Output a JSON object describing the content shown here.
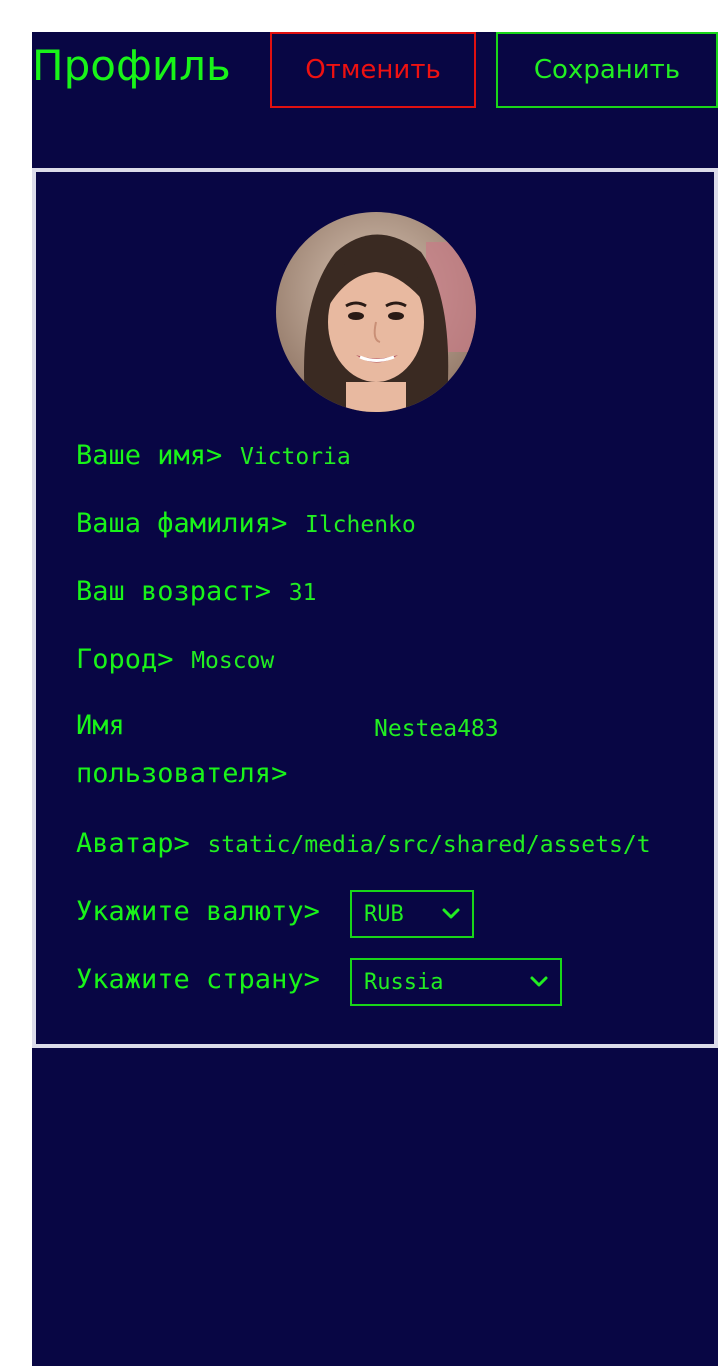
{
  "header": {
    "title": "Профиль",
    "cancel_label": "Отменить",
    "save_label": "Сохранить"
  },
  "profile": {
    "avatar_icon": "user-photo",
    "fields": {
      "first_name": {
        "label": "Ваше имя>",
        "value": "Victoria"
      },
      "last_name": {
        "label": "Ваша фамилия>",
        "value": "Ilchenko"
      },
      "age": {
        "label": "Ваш возраст>",
        "value": "31"
      },
      "city": {
        "label": "Город>",
        "value": "Moscow"
      },
      "username": {
        "label_line1": "Имя",
        "label_line2": "пользователя>",
        "value": "Nestea483"
      },
      "avatar": {
        "label": "Аватар>",
        "value": "static/media/src/shared/assets/t"
      },
      "currency": {
        "label": "Укажите валюту>",
        "selected": "RUB"
      },
      "country": {
        "label": "Укажите страну>",
        "selected": "Russia"
      }
    }
  },
  "colors": {
    "background": "#080644",
    "accent_green": "#19f419",
    "cancel_red": "#ee1111",
    "card_border": "#dcdcea"
  }
}
